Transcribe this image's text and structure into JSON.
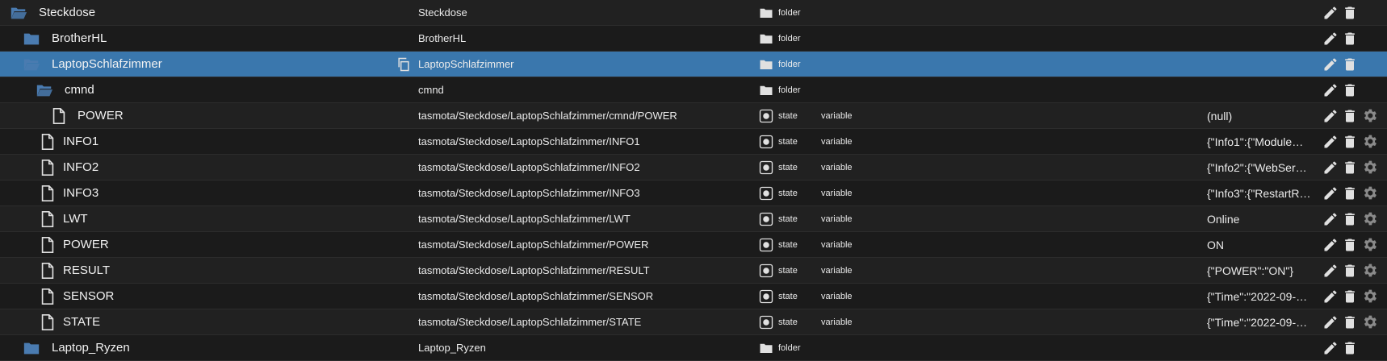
{
  "rows": [
    {
      "name": "Steckdose",
      "kind": "folder-open",
      "id": "Steckdose",
      "type": "folder",
      "role": "",
      "value": "",
      "selected": false,
      "settings": false
    },
    {
      "name": "BrotherHL",
      "kind": "folder",
      "id": "BrotherHL",
      "type": "folder",
      "role": "",
      "value": "",
      "selected": false,
      "settings": false
    },
    {
      "name": "LaptopSchlafzimmer",
      "kind": "folder-open",
      "id": "LaptopSchlafzimmer",
      "type": "folder",
      "role": "",
      "value": "",
      "selected": true,
      "settings": false
    },
    {
      "name": "cmnd",
      "kind": "folder-open",
      "id": "cmnd",
      "type": "folder",
      "role": "",
      "value": "",
      "selected": false,
      "settings": false
    },
    {
      "name": "POWER",
      "kind": "file",
      "id": "tasmota/Steckdose/LaptopSchlafzimmer/cmnd/POWER",
      "type": "state",
      "role": "variable",
      "value": "(null)",
      "selected": false,
      "settings": true
    },
    {
      "name": "INFO1",
      "kind": "file",
      "id": "tasmota/Steckdose/LaptopSchlafzimmer/INFO1",
      "type": "state",
      "role": "variable",
      "value": "{\"Info1\":{\"Module…",
      "selected": false,
      "settings": true
    },
    {
      "name": "INFO2",
      "kind": "file",
      "id": "tasmota/Steckdose/LaptopSchlafzimmer/INFO2",
      "type": "state",
      "role": "variable",
      "value": "{\"Info2\":{\"WebSer…",
      "selected": false,
      "settings": true
    },
    {
      "name": "INFO3",
      "kind": "file",
      "id": "tasmota/Steckdose/LaptopSchlafzimmer/INFO3",
      "type": "state",
      "role": "variable",
      "value": "{\"Info3\":{\"RestartR…",
      "selected": false,
      "settings": true
    },
    {
      "name": "LWT",
      "kind": "file",
      "id": "tasmota/Steckdose/LaptopSchlafzimmer/LWT",
      "type": "state",
      "role": "variable",
      "value": "Online",
      "selected": false,
      "settings": true
    },
    {
      "name": "POWER",
      "kind": "file",
      "id": "tasmota/Steckdose/LaptopSchlafzimmer/POWER",
      "type": "state",
      "role": "variable",
      "value": "ON",
      "selected": false,
      "settings": true
    },
    {
      "name": "RESULT",
      "kind": "file",
      "id": "tasmota/Steckdose/LaptopSchlafzimmer/RESULT",
      "type": "state",
      "role": "variable",
      "value": "{\"POWER\":\"ON\"}",
      "selected": false,
      "settings": true
    },
    {
      "name": "SENSOR",
      "kind": "file",
      "id": "tasmota/Steckdose/LaptopSchlafzimmer/SENSOR",
      "type": "state",
      "role": "variable",
      "value": "{\"Time\":\"2022-09-…",
      "selected": false,
      "settings": true
    },
    {
      "name": "STATE",
      "kind": "file",
      "id": "tasmota/Steckdose/LaptopSchlafzimmer/STATE",
      "type": "state",
      "role": "variable",
      "value": "{\"Time\":\"2022-09-…",
      "selected": false,
      "settings": true
    },
    {
      "name": "Laptop_Ryzen",
      "kind": "folder",
      "id": "Laptop_Ryzen",
      "type": "folder",
      "role": "",
      "value": "",
      "selected": false,
      "settings": false
    }
  ],
  "colors": {
    "folder": "#4a7bb0",
    "selected": "#3a77ad",
    "icon": "#e0e0e0",
    "gear": "#8a8a8a"
  }
}
